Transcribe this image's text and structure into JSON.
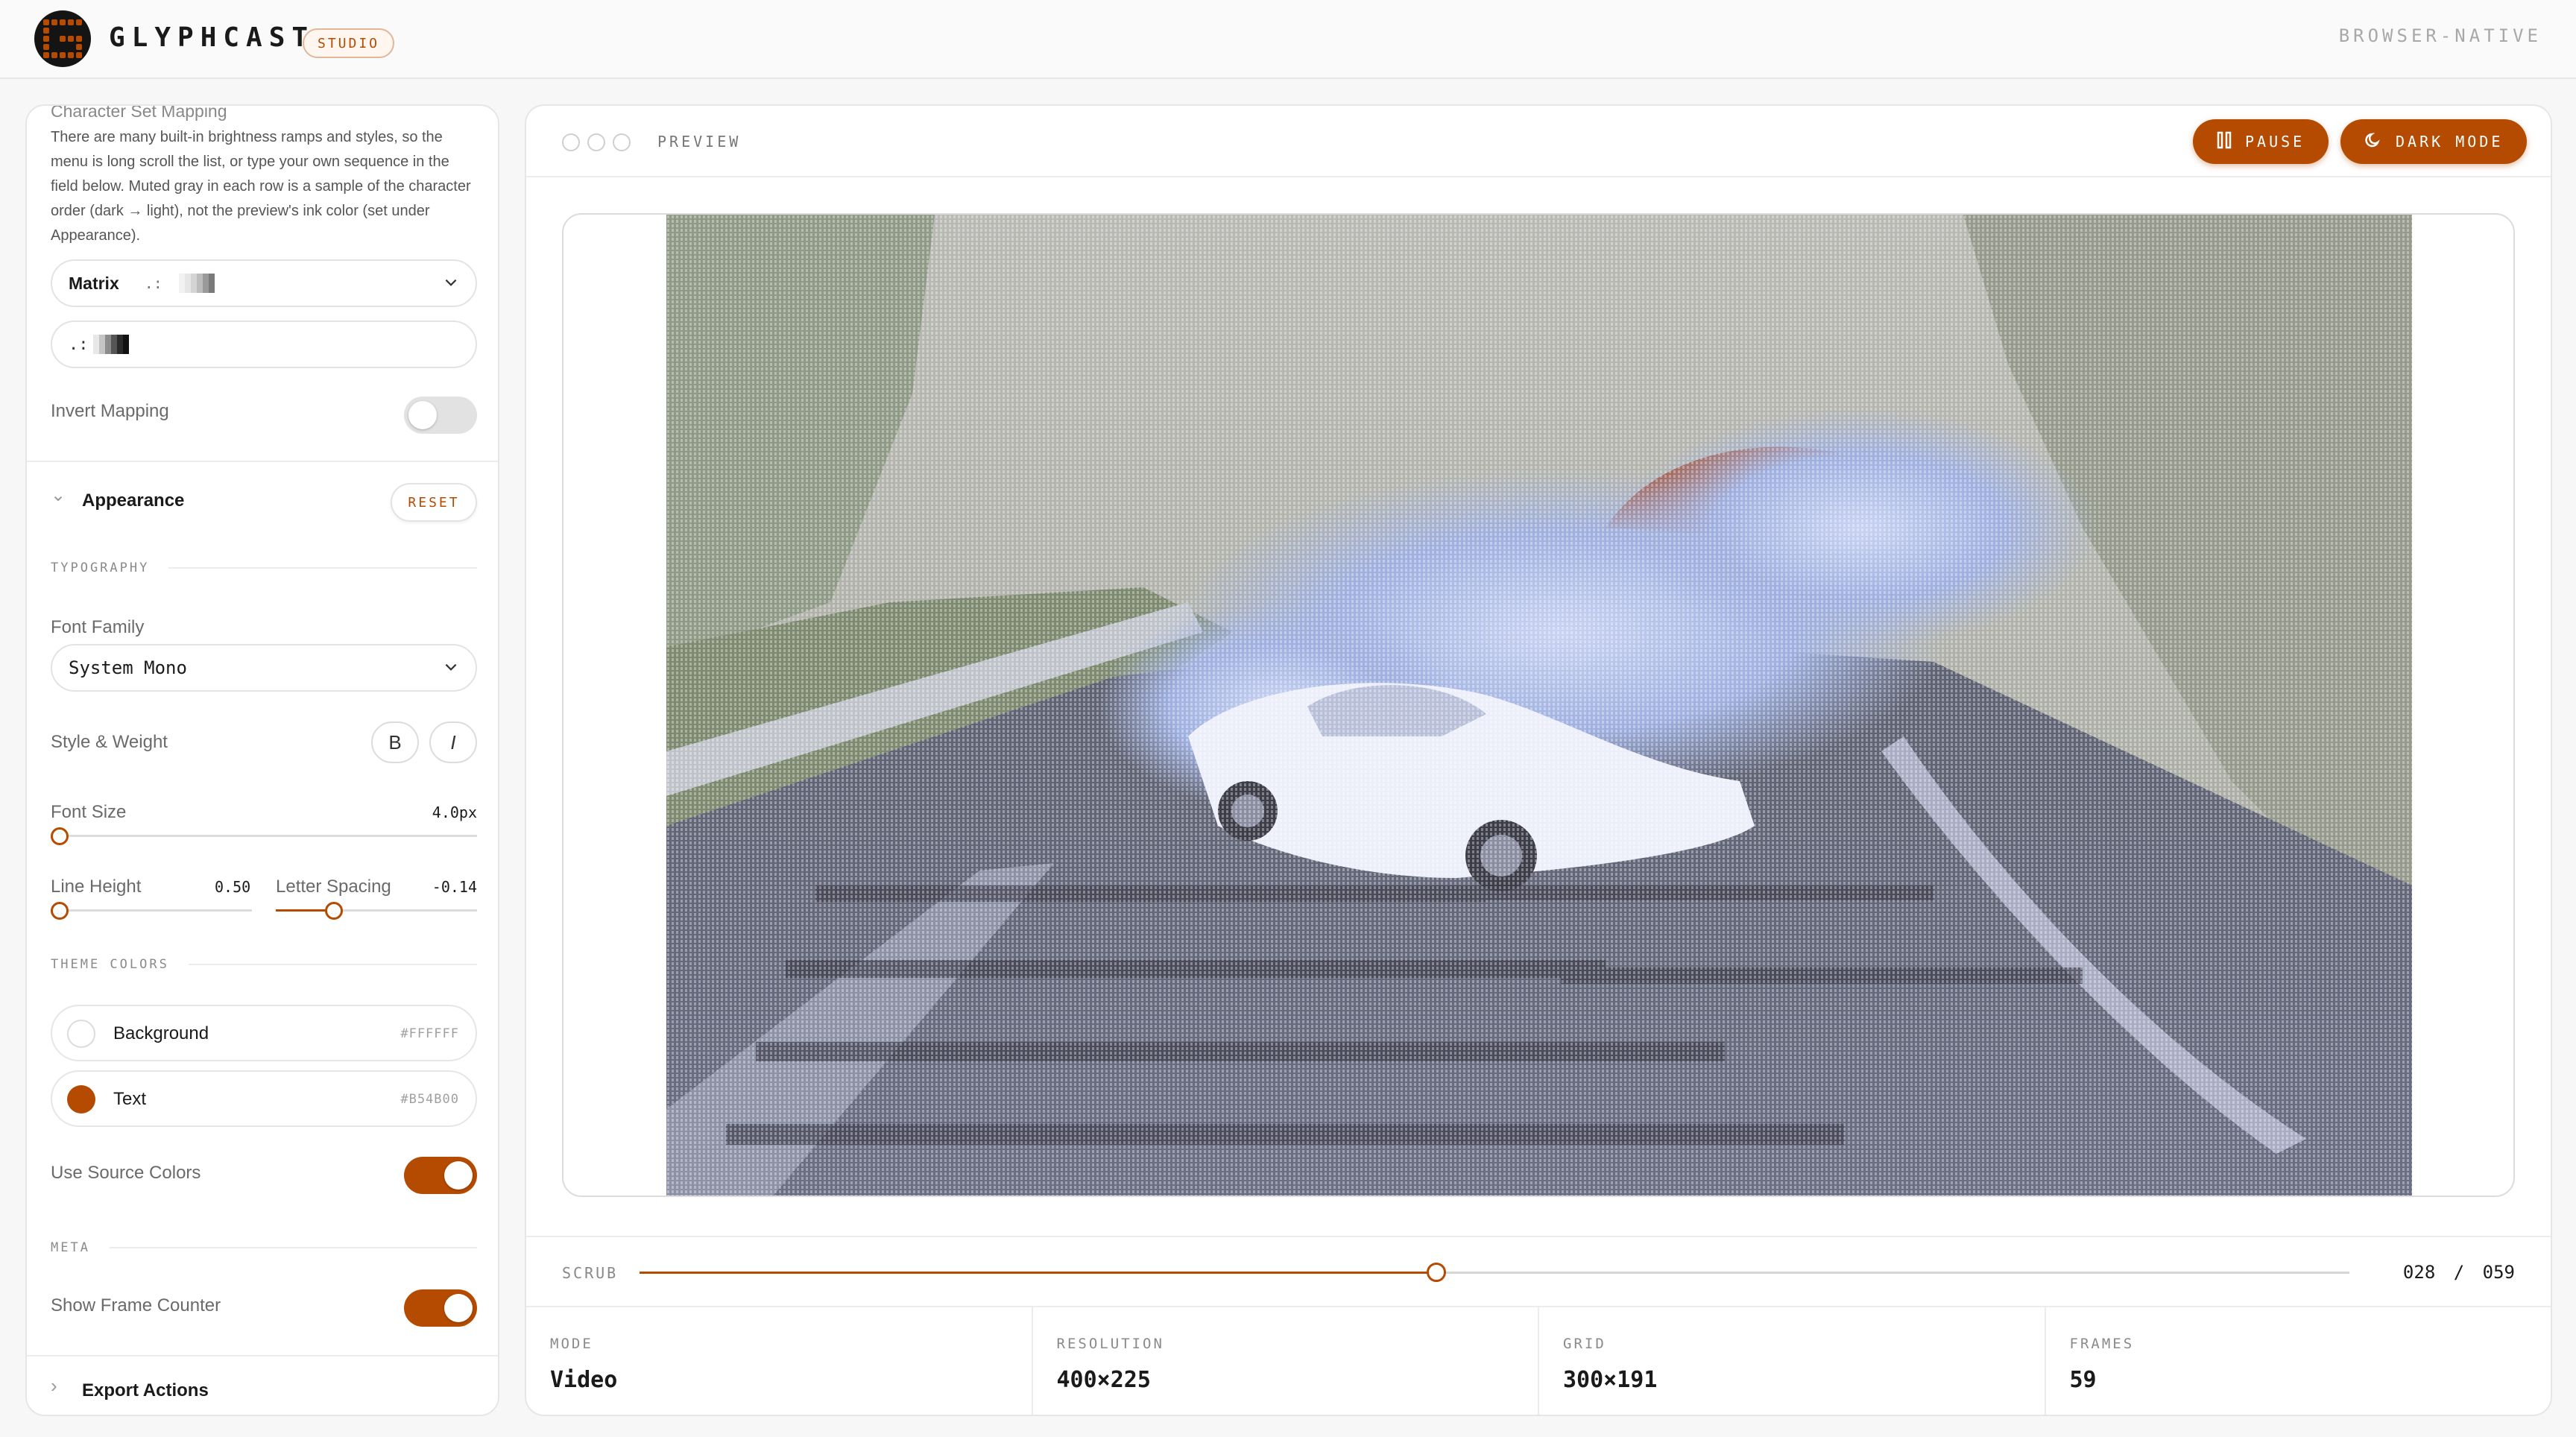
{
  "header": {
    "brand": "GLYPHCAST",
    "badge": "STUDIO",
    "right_label": "BROWSER-NATIVE",
    "accent": "#B54B00"
  },
  "sidebar": {
    "charset": {
      "title": "Character Set Mapping",
      "help": "There are many built-in brightness ramps and styles, so the menu is long scroll the list, or type your own sequence in the field below. Muted gray in each row is a sample of the character order (dark → light), not the preview's ink color (set under Appearance).",
      "preset_name": "Matrix",
      "preset_sample": " .:",
      "custom_value": " .:",
      "invert_label": "Invert Mapping",
      "invert_on": false
    },
    "appearance": {
      "title": "Appearance",
      "reset_label": "RESET",
      "typography_title": "TYPOGRAPHY",
      "font_family_label": "Font Family",
      "font_family_value": "System Mono",
      "style_weight_label": "Style & Weight",
      "bold_label": "B",
      "italic_label": "I",
      "font_size_label": "Font Size",
      "font_size_value": "4.0px",
      "font_size_fraction": 0.0,
      "line_height_label": "Line Height",
      "line_height_value": "0.50",
      "line_height_fraction": 0.0,
      "letter_spacing_label": "Letter Spacing",
      "letter_spacing_value": "-0.14",
      "letter_spacing_fraction": 0.27,
      "theme_title": "THEME COLORS",
      "colors": [
        {
          "name": "Background",
          "hex": "#FFFFFF"
        },
        {
          "name": "Text",
          "hex": "#B54B00"
        }
      ],
      "source_colors_label": "Use Source Colors",
      "source_colors_on": true,
      "meta_title": "META",
      "frame_counter_label": "Show Frame Counter",
      "frame_counter_on": true
    },
    "export": {
      "title": "Export Actions"
    }
  },
  "preview": {
    "label": "PREVIEW",
    "pause_label": "PAUSE",
    "dark_mode_label": "DARK MODE",
    "scrub_label": "SCRUB",
    "current_frame": "028",
    "separator": "/",
    "total_frames": "059",
    "scrub_fraction": 0.466,
    "stats": [
      {
        "key": "MODE",
        "value": "Video"
      },
      {
        "key": "RESOLUTION",
        "value": "400×225"
      },
      {
        "key": "GRID",
        "value": "300×191"
      },
      {
        "key": "FRAMES",
        "value": "59"
      }
    ]
  }
}
